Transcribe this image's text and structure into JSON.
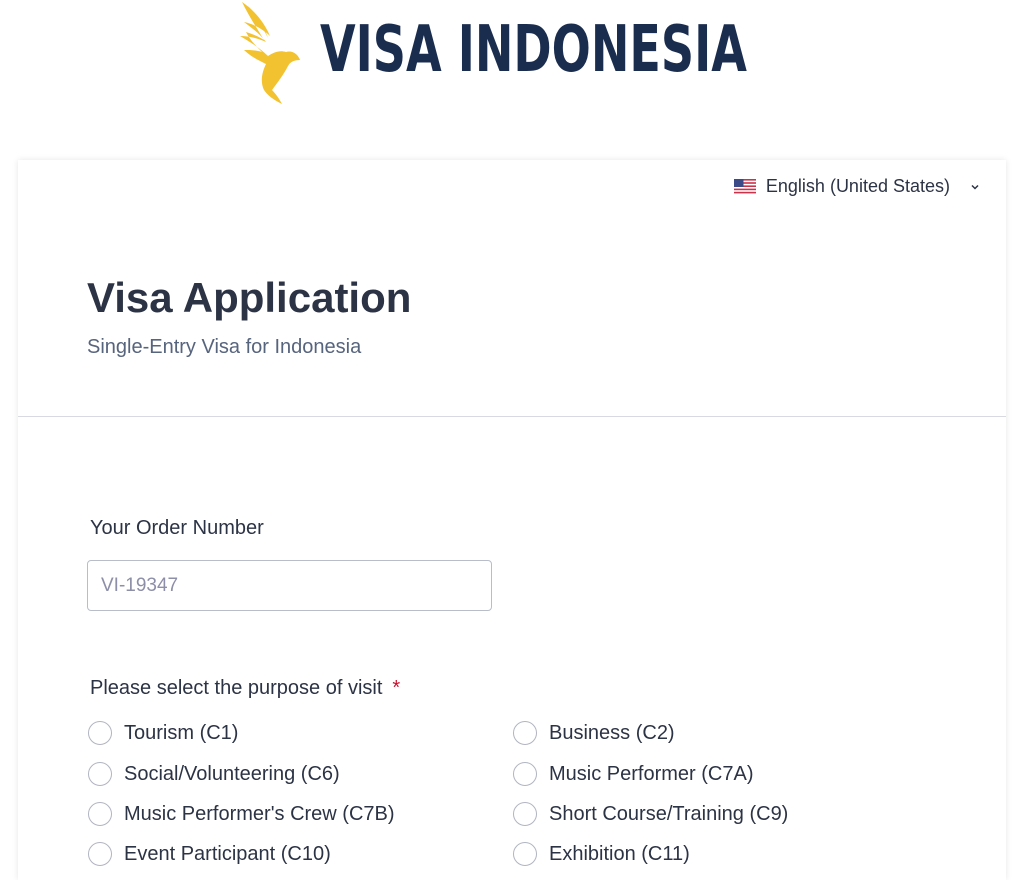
{
  "brand": {
    "name": "VISA INDONESIA",
    "logo_icon": "golden-bird-icon",
    "colors": {
      "text": "#1b2d4f",
      "bird": "#f2c230"
    }
  },
  "language": {
    "flag_icon": "us-flag-icon",
    "label": "English (United States)",
    "chevron_icon": "chevron-down-icon"
  },
  "form": {
    "title": "Visa Application",
    "subtitle": "Single-Entry Visa for Indonesia",
    "order": {
      "label": "Your Order Number",
      "placeholder": "VI-19347",
      "value": ""
    },
    "purpose": {
      "label": "Please select the purpose of visit",
      "required_marker": "*",
      "options": [
        {
          "label": "Tourism (C1)"
        },
        {
          "label": "Business (C2)"
        },
        {
          "label": "Social/Volunteering (C6)"
        },
        {
          "label": "Music Performer (C7A)"
        },
        {
          "label": "Music Performer's Crew (C7B)"
        },
        {
          "label": "Short Course/Training (C9)"
        },
        {
          "label": "Event Participant (C10)"
        },
        {
          "label": "Exhibition (C11)"
        }
      ]
    }
  },
  "colors": {
    "accent_required": "#c8102e",
    "text_primary": "#2c3345",
    "text_secondary": "#57647e"
  }
}
